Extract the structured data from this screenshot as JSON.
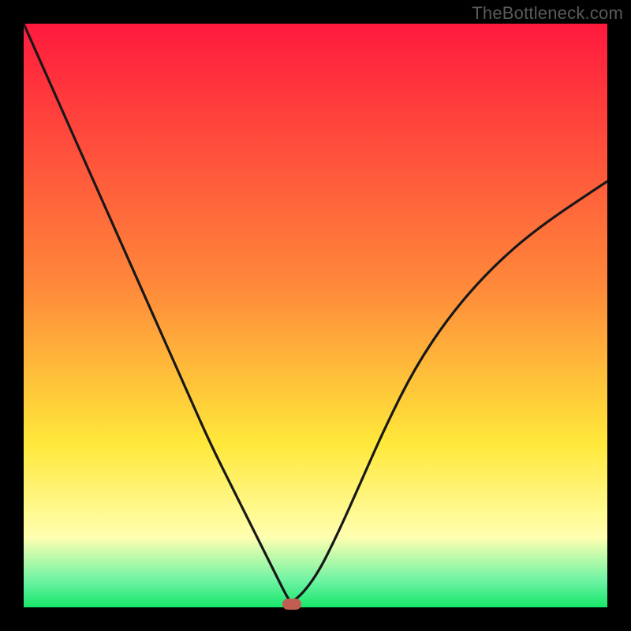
{
  "watermark": "TheBottleneck.com",
  "colors": {
    "red_top": "#ff1a3d",
    "orange": "#ff893a",
    "yellow": "#ffe83a",
    "pale_yellow": "#ffffb0",
    "mint": "#6cf3a3",
    "green": "#17e66a",
    "black": "#000000",
    "curve": "#181818",
    "marker": "#c15d52"
  },
  "chart_data": {
    "type": "line",
    "title": "",
    "xlabel": "",
    "ylabel": "",
    "xlim": [
      0,
      100
    ],
    "ylim": [
      0,
      100
    ],
    "series": [
      {
        "name": "curve",
        "x": [
          0,
          4,
          8,
          12,
          16,
          20,
          24,
          28,
          32,
          36,
          40,
          43,
          45,
          46,
          50,
          54,
          58,
          62,
          67,
          73,
          80,
          88,
          100
        ],
        "y": [
          100,
          91,
          82,
          73,
          64,
          55,
          46,
          37,
          28,
          20,
          12,
          6,
          2,
          0.5,
          5,
          13,
          22,
          31,
          41,
          50,
          58,
          65,
          73
        ]
      }
    ],
    "marker": {
      "x": 46,
      "y": 0.5
    },
    "gradient_stops": [
      {
        "pos": 0.0,
        "key": "red_top"
      },
      {
        "pos": 0.45,
        "key": "orange"
      },
      {
        "pos": 0.72,
        "key": "yellow"
      },
      {
        "pos": 0.88,
        "key": "pale_yellow"
      },
      {
        "pos": 0.955,
        "key": "mint"
      },
      {
        "pos": 1.0,
        "key": "green"
      }
    ]
  }
}
